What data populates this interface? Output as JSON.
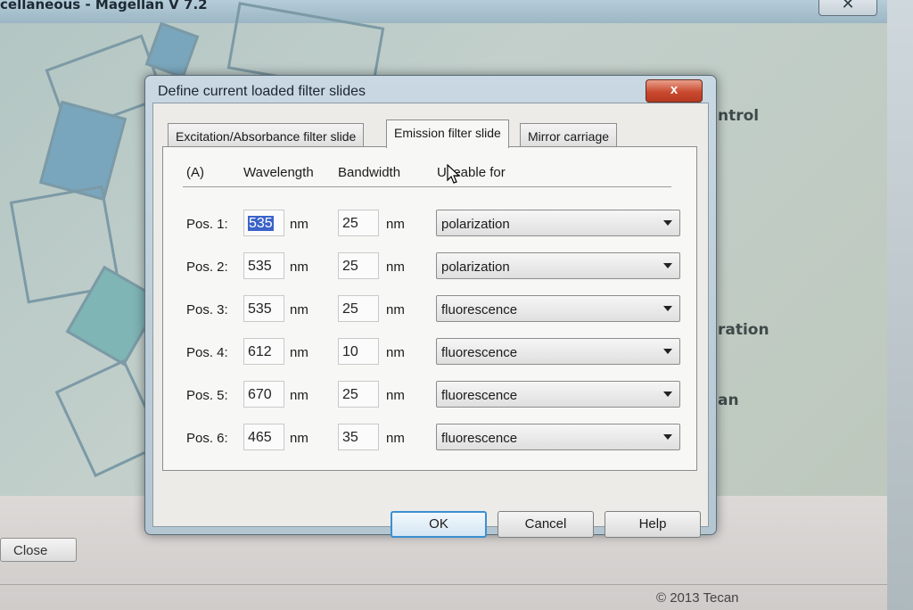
{
  "background_window": {
    "title": "cellaneous - Magellan V 7.2",
    "close_glyph": "✕",
    "side_labels": [
      "ntrol",
      "ration",
      "an"
    ],
    "close_button_label": "Close",
    "copyright": "© 2013 Tecan"
  },
  "dialog": {
    "title": "Define current loaded filter slides",
    "close_glyph": "x",
    "tabs": [
      {
        "label": "Excitation/Absorbance filter slide",
        "active": false
      },
      {
        "label": "Emission filter slide",
        "active": true
      },
      {
        "label": "Mirror carriage",
        "active": false
      }
    ],
    "headers": {
      "col_a": "(A)",
      "wavelength": "Wavelength",
      "bandwidth": "Bandwidth",
      "useable_for": "Useable for"
    },
    "unit": "nm",
    "rows": [
      {
        "label": "Pos. 1:",
        "wavelength": "535",
        "bandwidth": "25",
        "useable_for": "polarization"
      },
      {
        "label": "Pos. 2:",
        "wavelength": "535",
        "bandwidth": "25",
        "useable_for": "polarization"
      },
      {
        "label": "Pos. 3:",
        "wavelength": "535",
        "bandwidth": "25",
        "useable_for": "fluorescence"
      },
      {
        "label": "Pos. 4:",
        "wavelength": "612",
        "bandwidth": "10",
        "useable_for": "fluorescence"
      },
      {
        "label": "Pos. 5:",
        "wavelength": "670",
        "bandwidth": "25",
        "useable_for": "fluorescence"
      },
      {
        "label": "Pos. 6:",
        "wavelength": "465",
        "bandwidth": "35",
        "useable_for": "fluorescence"
      }
    ],
    "buttons": {
      "ok": "OK",
      "cancel": "Cancel",
      "help": "Help"
    }
  },
  "colors": {
    "selection": "#3a62c9",
    "close_red": "#c94a2f",
    "default_button_border": "#3c8fd0"
  }
}
